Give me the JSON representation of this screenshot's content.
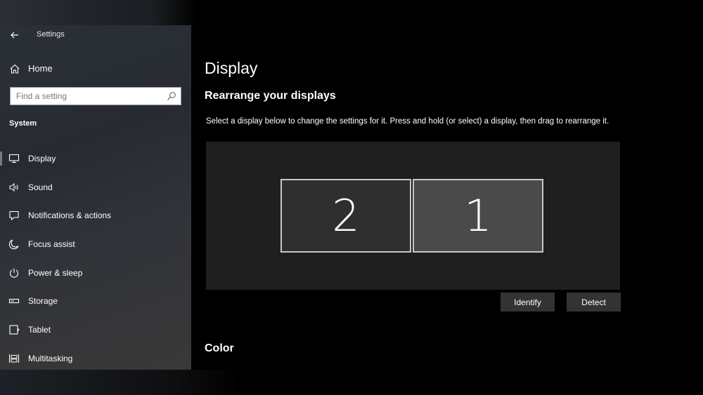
{
  "window": {
    "title": "Settings"
  },
  "sidebar": {
    "home_label": "Home",
    "search": {
      "placeholder": "Find a setting",
      "value": ""
    },
    "section": "System",
    "items": [
      {
        "label": "Display",
        "icon": "monitor-icon",
        "selected": true
      },
      {
        "label": "Sound",
        "icon": "speaker-icon",
        "selected": false
      },
      {
        "label": "Notifications & actions",
        "icon": "notification-icon",
        "selected": false
      },
      {
        "label": "Focus assist",
        "icon": "moon-icon",
        "selected": false
      },
      {
        "label": "Power & sleep",
        "icon": "power-icon",
        "selected": false
      },
      {
        "label": "Storage",
        "icon": "storage-icon",
        "selected": false
      },
      {
        "label": "Tablet",
        "icon": "tablet-icon",
        "selected": false
      },
      {
        "label": "Multitasking",
        "icon": "multitasking-icon",
        "selected": false
      }
    ]
  },
  "main": {
    "page_title": "Display",
    "arrange_title": "Rearrange your displays",
    "arrange_description": "Select a display below to change the settings for it. Press and hold (or select) a display, then drag to rearrange it.",
    "displays": [
      {
        "number": "2",
        "selected": false
      },
      {
        "number": "1",
        "selected": true
      }
    ],
    "identify_label": "Identify",
    "detect_label": "Detect",
    "color_title": "Color"
  },
  "colors": {
    "monitor_selected": "#4a4a4a",
    "monitor_unselected": "#2f2f2f",
    "button_bg": "#333333"
  }
}
